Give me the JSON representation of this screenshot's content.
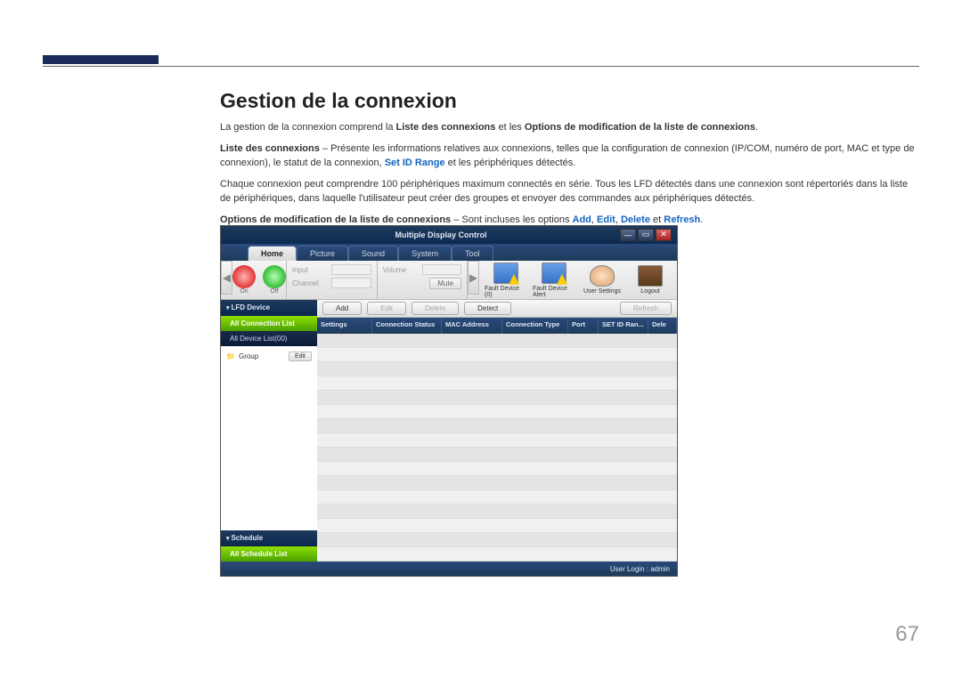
{
  "page": {
    "title": "Gestion de la connexion",
    "number": "67"
  },
  "para1": {
    "lead": "La gestion de la connexion comprend la ",
    "b1": "Liste des connexions",
    "mid": " et les ",
    "b2": "Options de modification de la liste de connexions",
    "end": "."
  },
  "para2": {
    "b1": "Liste des connexions",
    "t1": " – Présente les informations relatives aux connexions, telles que la configuration de connexion (IP/COM, numéro de port, MAC et type de connexion), le statut de la connexion, ",
    "link1": "Set ID Range",
    "t2": " et les périphériques détectés."
  },
  "para3": "Chaque connexion peut comprendre 100 périphériques maximum connectés en série. Tous les LFD détectés dans une connexion sont répertoriés dans la liste de périphériques, dans laquelle l'utilisateur peut créer des groupes et envoyer des commandes aux périphériques détectés.",
  "para4": {
    "b1": "Options de modification de la liste de connexions",
    "t1": " – Sont incluses les options ",
    "l1": "Add",
    "c1": ", ",
    "l2": "Edit",
    "c2": ", ",
    "l3": "Delete",
    "c3": " et ",
    "l4": "Refresh",
    "end": "."
  },
  "app": {
    "title": "Multiple Display Control",
    "tabs": {
      "home": "Home",
      "picture": "Picture",
      "sound": "Sound",
      "system": "System",
      "tool": "Tool"
    },
    "power": {
      "on": "On",
      "off": "Off"
    },
    "props": {
      "input": "Input",
      "channel": "Channel",
      "volume": "Volume",
      "mute": "Mute"
    },
    "bigicons": {
      "fault1": "Fault Device (0)",
      "fault2": "Fault Device Alert",
      "user": "User Settings",
      "logout": "Logout"
    },
    "actions": {
      "add": "Add",
      "edit": "Edit",
      "delete": "Delete",
      "detect": "Detect",
      "refresh": "Refresh"
    },
    "sidebar": {
      "lfd": "LFD Device",
      "allconn": "All Connection List",
      "alldev": "All Device List(00)",
      "group": "Group",
      "groupedit": "Edit",
      "schedule": "Schedule",
      "allsched": "All Schedule List"
    },
    "columns": {
      "settings": "Settings",
      "status": "Connection Status",
      "mac": "MAC Address",
      "ctype": "Connection Type",
      "port": "Port",
      "setid": "SET ID Ran...",
      "dele": "Dele"
    },
    "status": "User Login : admin"
  }
}
